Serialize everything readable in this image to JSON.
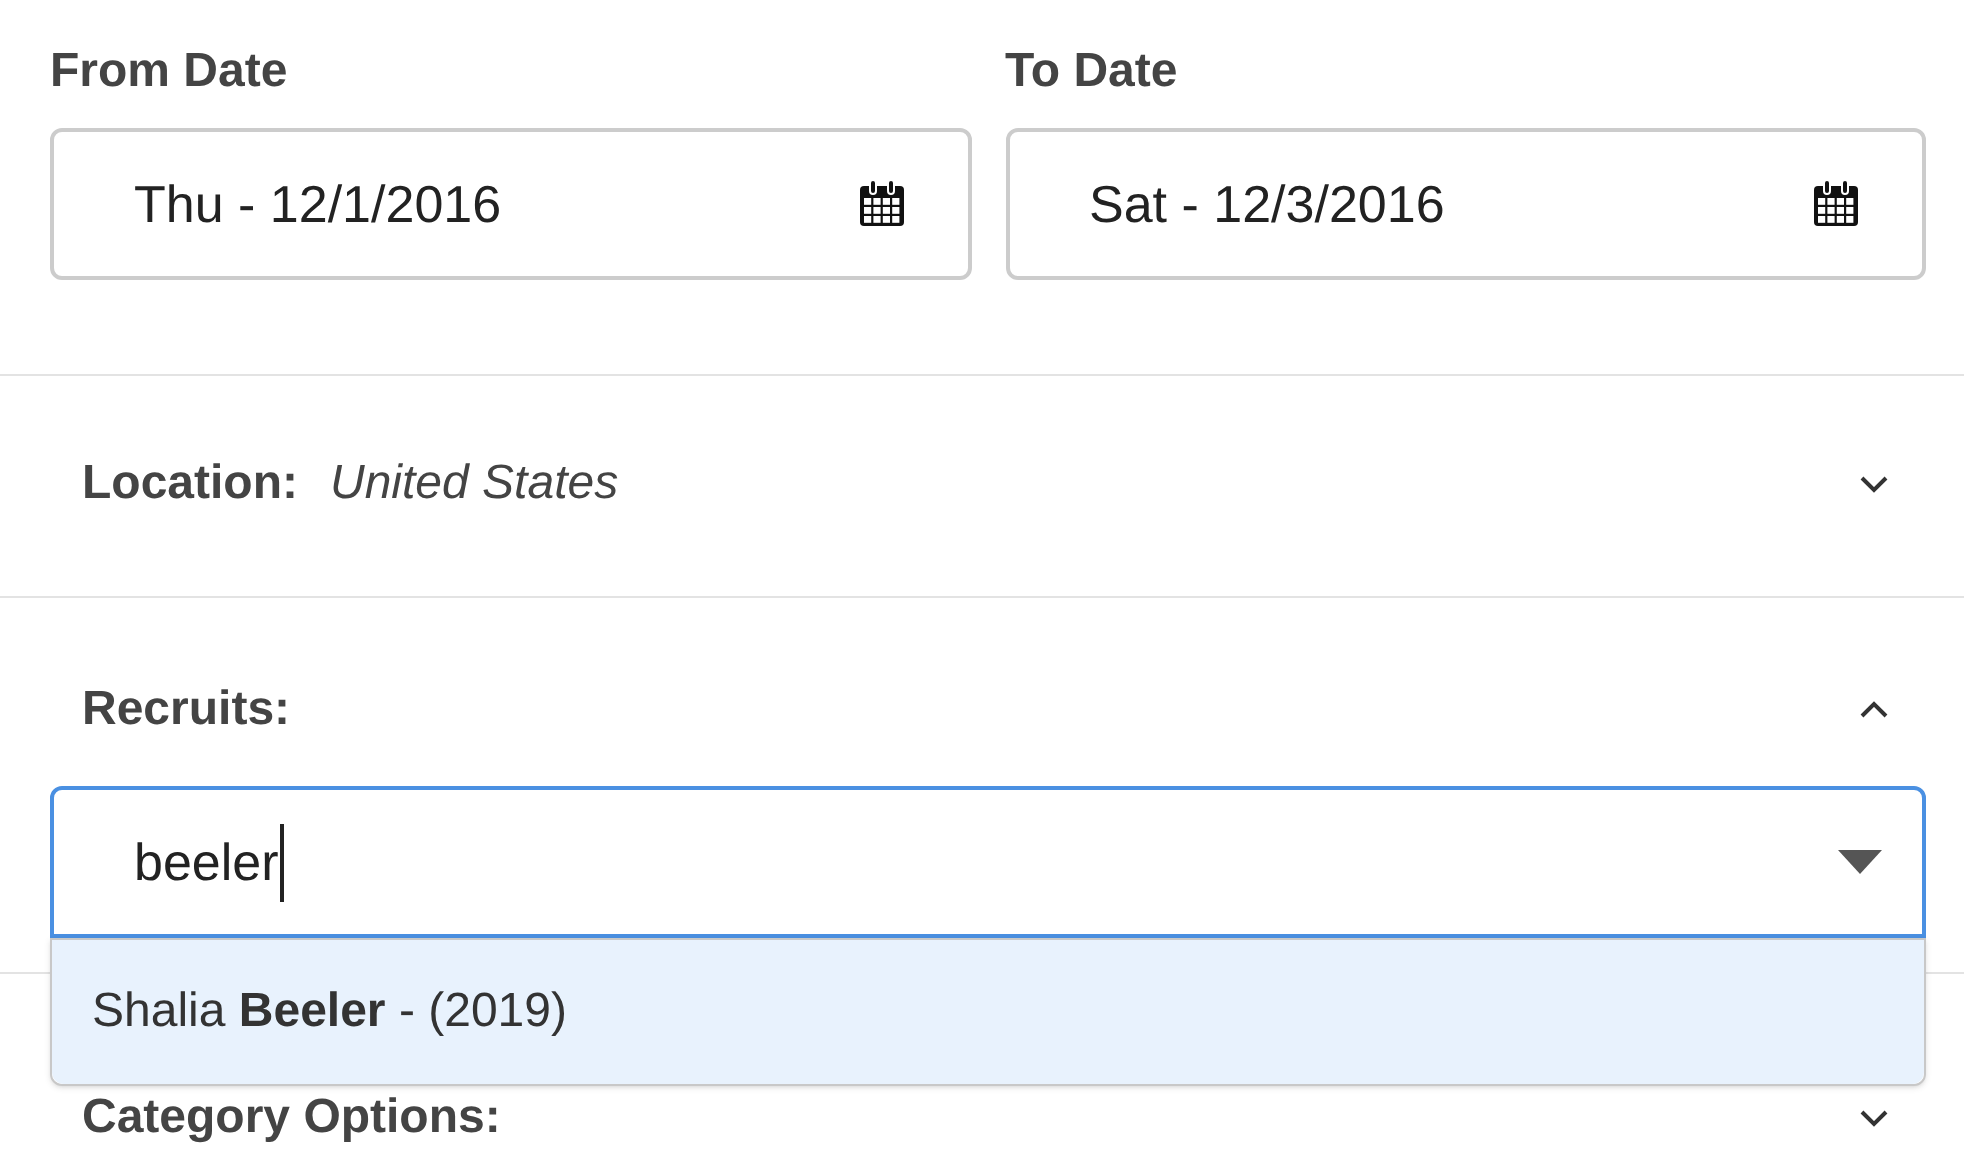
{
  "from_date": {
    "label": "From Date",
    "value": "Thu - 12/1/2016"
  },
  "to_date": {
    "label": "To Date",
    "value": "Sat - 12/3/2016"
  },
  "sections": [
    {
      "kind": "summary",
      "label": "Location:",
      "value": "United States",
      "expanded": false
    },
    {
      "kind": "search",
      "label": "Recruits:",
      "expanded": true,
      "query": "beeler",
      "suggestions": [
        {
          "text": "Shalia **Beeler** - (2019)",
          "selected": true
        }
      ]
    },
    {
      "kind": "summary",
      "label": "Category Options:",
      "expanded": false
    }
  ]
}
